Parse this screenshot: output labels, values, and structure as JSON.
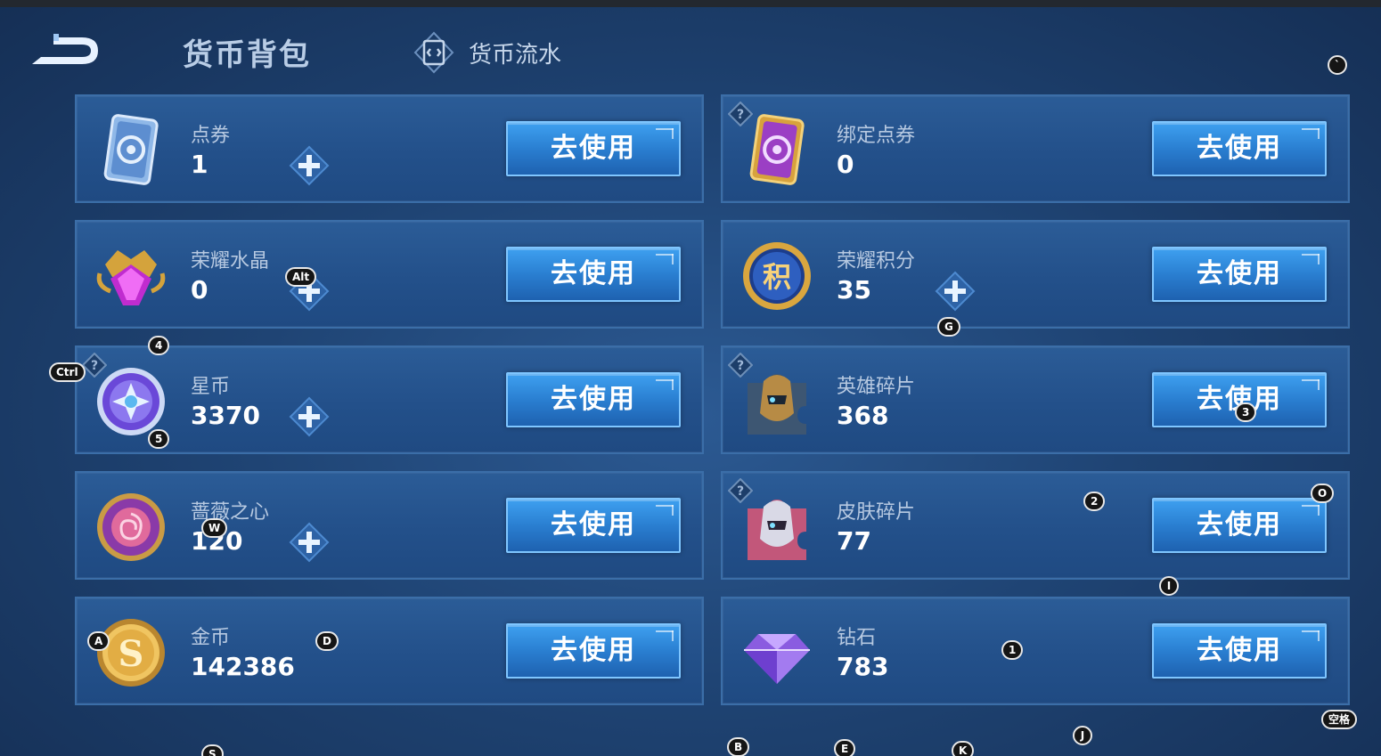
{
  "header": {
    "title": "货币背包",
    "flow_label": "货币流水"
  },
  "use_label": "去使用",
  "currencies": [
    {
      "name": "点券",
      "value": "1",
      "has_plus": true,
      "has_help": false,
      "icon": "voucher-card-icon"
    },
    {
      "name": "绑定点券",
      "value": "0",
      "has_plus": false,
      "has_help": true,
      "icon": "bound-voucher-card-icon"
    },
    {
      "name": "荣耀水晶",
      "value": "0",
      "has_plus": true,
      "has_help": false,
      "icon": "glory-crystal-icon"
    },
    {
      "name": "荣耀积分",
      "value": "35",
      "has_plus": true,
      "has_help": false,
      "icon": "glory-points-icon"
    },
    {
      "name": "星币",
      "value": "3370",
      "has_plus": true,
      "has_help": true,
      "icon": "star-coin-icon"
    },
    {
      "name": "英雄碎片",
      "value": "368",
      "has_plus": false,
      "has_help": true,
      "icon": "hero-shard-icon"
    },
    {
      "name": "蔷薇之心",
      "value": "120",
      "has_plus": true,
      "has_help": false,
      "icon": "rose-heart-icon"
    },
    {
      "name": "皮肤碎片",
      "value": "77",
      "has_plus": false,
      "has_help": true,
      "icon": "skin-shard-icon"
    },
    {
      "name": "金币",
      "value": "142386",
      "has_plus": false,
      "has_help": false,
      "icon": "gold-coin-icon"
    },
    {
      "name": "钻石",
      "value": "783",
      "has_plus": false,
      "has_help": false,
      "icon": "diamond-icon"
    }
  ],
  "key_hints": [
    {
      "key": "`"
    },
    {
      "key": "Alt"
    },
    {
      "key": "G"
    },
    {
      "key": "4"
    },
    {
      "key": "Ctrl"
    },
    {
      "key": "5"
    },
    {
      "key": "3"
    },
    {
      "key": "2"
    },
    {
      "key": "O"
    },
    {
      "key": "W"
    },
    {
      "key": "I"
    },
    {
      "key": "A"
    },
    {
      "key": "D"
    },
    {
      "key": "1"
    },
    {
      "key": "空格"
    },
    {
      "key": "J"
    },
    {
      "key": "S"
    },
    {
      "key": "B"
    },
    {
      "key": "E"
    },
    {
      "key": "K"
    }
  ]
}
